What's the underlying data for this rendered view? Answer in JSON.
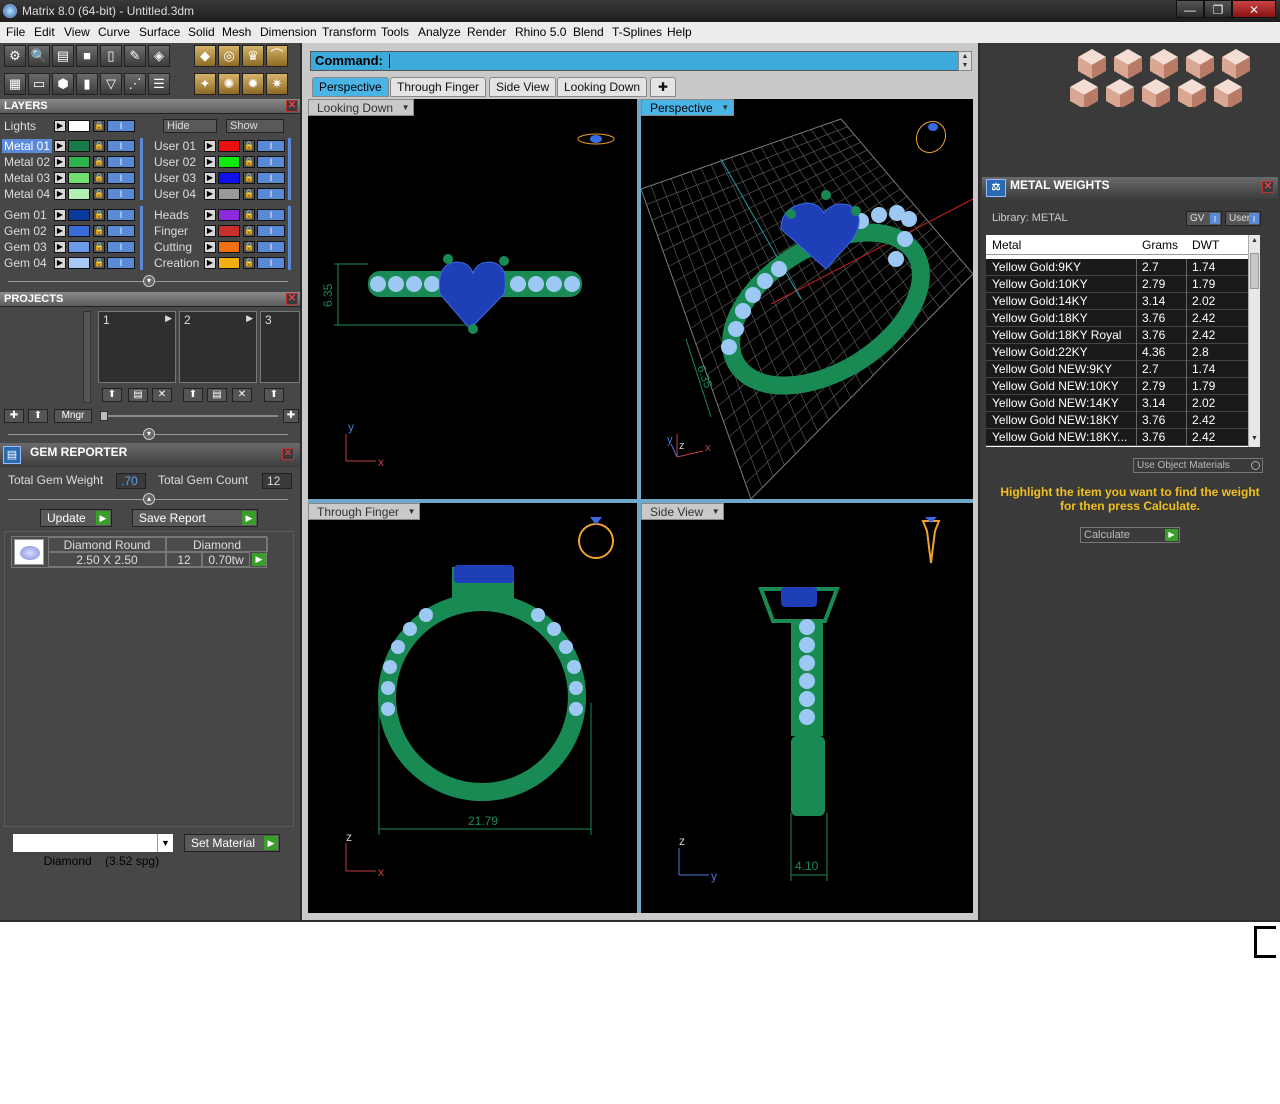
{
  "window": {
    "title": "Matrix 8.0 (64-bit) - Untitled.3dm",
    "minimize": "—",
    "restore": "❐",
    "close": "✕"
  },
  "menu": [
    "File",
    "Edit",
    "View",
    "Curve",
    "Surface",
    "Solid",
    "Mesh",
    "Dimension",
    "Transform",
    "Tools",
    "Analyze",
    "Render",
    "Rhino 5.0",
    "Blend",
    "T-Splines",
    "Help"
  ],
  "layers": {
    "title": "LAYERS",
    "lights": "Lights",
    "hide": "Hide",
    "show": "Show",
    "left": [
      {
        "name": "Metal 01",
        "color": "#1a7a4a",
        "selected": true
      },
      {
        "name": "Metal 02",
        "color": "#2fb34f"
      },
      {
        "name": "Metal 03",
        "color": "#6fe070"
      },
      {
        "name": "Metal 04",
        "color": "#b5f0b0"
      },
      {
        "name": "Gem 01",
        "color": "#0a3a9a"
      },
      {
        "name": "Gem 02",
        "color": "#3a6ad8"
      },
      {
        "name": "Gem 03",
        "color": "#6a9ae8"
      },
      {
        "name": "Gem 04",
        "color": "#a8c8f4"
      }
    ],
    "right": [
      {
        "name": "User 01",
        "color": "#e81010"
      },
      {
        "name": "User 02",
        "color": "#10e810"
      },
      {
        "name": "User 03",
        "color": "#1010e8"
      },
      {
        "name": "User 04",
        "color": "#9a9a9a"
      },
      {
        "name": "Heads",
        "color": "#8a2ad8"
      },
      {
        "name": "Finger",
        "color": "#c83030"
      },
      {
        "name": "Cutting",
        "color": "#f07010"
      },
      {
        "name": "Creation",
        "color": "#f0b010"
      }
    ]
  },
  "projects": {
    "title": "PROJECTS",
    "slots": [
      "1",
      "2",
      "3"
    ],
    "mngr": "Mngr"
  },
  "gem_reporter": {
    "title": "GEM REPORTER",
    "total_weight_label": "Total Gem Weight",
    "total_weight": ".70",
    "total_count_label": "Total Gem Count",
    "total_count": "12",
    "update": "Update",
    "save_report": "Save Report",
    "gem": {
      "shape": "Diamond Round",
      "size": "2.50 X 2.50",
      "material": "Diamond",
      "count": "12",
      "tw": "0.70tw"
    },
    "material_select": "Diamond    (3.52 spg)",
    "set_material": "Set Material"
  },
  "command": {
    "label": "Command:"
  },
  "view_tabs": [
    "Perspective",
    "Through Finger",
    "Side View",
    "Looking Down"
  ],
  "add_tab": "✚",
  "viewports": {
    "looking_down": {
      "label": "Looking Down",
      "dim": "6.35",
      "axis_x": "x",
      "axis_y": "y"
    },
    "perspective": {
      "label": "Perspective",
      "dim": "6.35",
      "axis_x": "x",
      "axis_y": "y",
      "axis_z": "z"
    },
    "through_finger": {
      "label": "Through Finger",
      "dim": "21.79",
      "axis_x": "x",
      "axis_z": "z"
    },
    "side_view": {
      "label": "Side View",
      "dim": "4.10",
      "axis_y": "y",
      "axis_z": "z"
    }
  },
  "metal_weights": {
    "title": "METAL WEIGHTS",
    "library": "Library: METAL",
    "gv": "GV",
    "user": "User",
    "columns": [
      "Metal",
      "Grams",
      "DWT"
    ],
    "rows": [
      [
        "Yellow Gold:9KY",
        "2.7",
        "1.74"
      ],
      [
        "Yellow Gold:10KY",
        "2.79",
        "1.79"
      ],
      [
        "Yellow Gold:14KY",
        "3.14",
        "2.02"
      ],
      [
        "Yellow Gold:18KY",
        "3.76",
        "2.42"
      ],
      [
        "Yellow Gold:18KY Royal",
        "3.76",
        "2.42"
      ],
      [
        "Yellow Gold:22KY",
        "4.36",
        "2.8"
      ],
      [
        "Yellow Gold NEW:9KY",
        "2.7",
        "1.74"
      ],
      [
        "Yellow Gold NEW:10KY",
        "2.79",
        "1.79"
      ],
      [
        "Yellow Gold NEW:14KY",
        "3.14",
        "2.02"
      ],
      [
        "Yellow Gold NEW:18KY",
        "3.76",
        "2.42"
      ],
      [
        "Yellow Gold NEW:18KY...",
        "3.76",
        "2.42"
      ]
    ],
    "use_object_materials": "Use Object Materials",
    "instruction": "Highlight the item you want to find the weight for then press Calculate.",
    "calculate": "Calculate"
  }
}
